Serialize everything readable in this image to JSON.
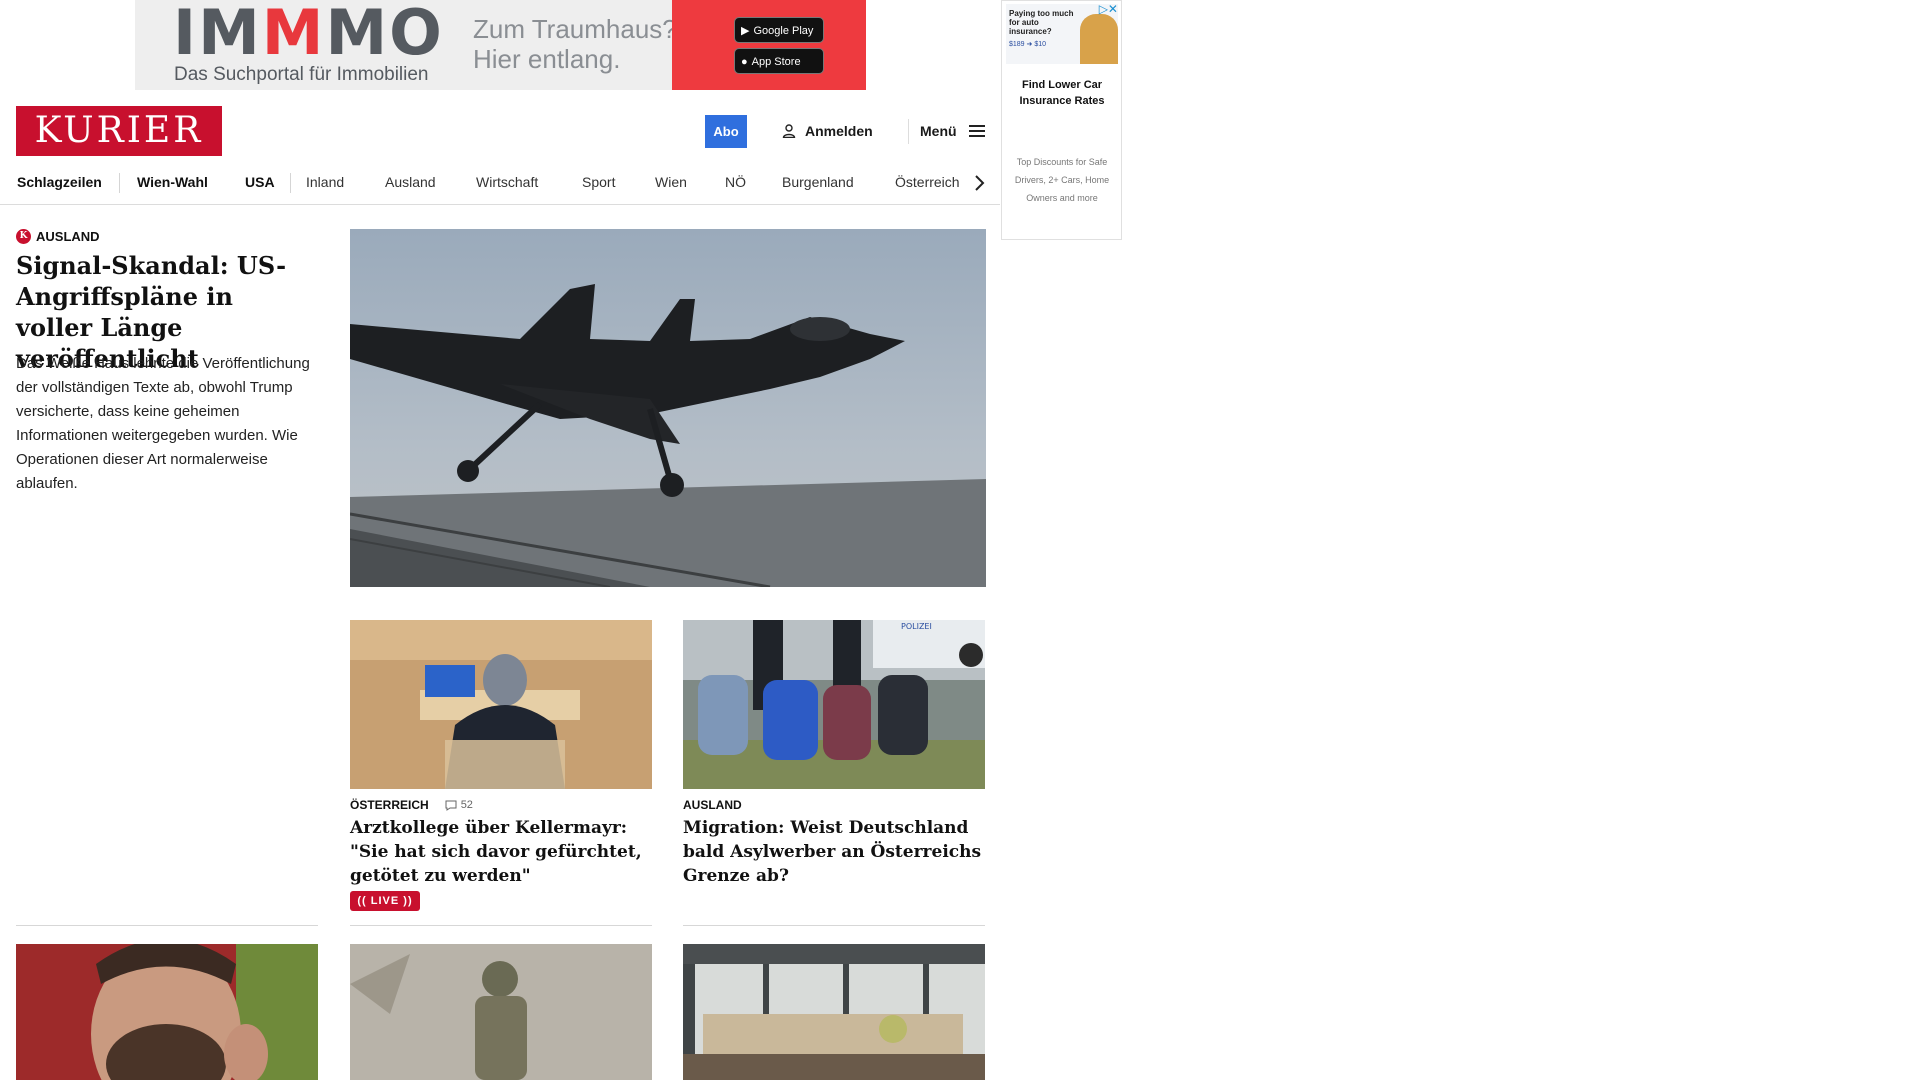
{
  "ad_banner": {
    "brand": "IMMMO",
    "tagline": "Das Suchportal für Immobilien",
    "slogan_line1": "Zum Traumhaus?",
    "slogan_line2": "Hier entlang.",
    "google_play": "Google Play",
    "app_store": "App Store",
    "colors": {
      "accent": "#ee3a3f",
      "text": "#555a60"
    }
  },
  "ad_side": {
    "thumb_text": "Paying too much for auto insurance?",
    "thumb_price": "$189 ➜ $10",
    "headline": "Find Lower Car Insurance Rates",
    "description": "Top Discounts for Safe Drivers, 2+ Cars, Home Owners and more"
  },
  "header": {
    "logo": "KURIER",
    "abo": "Abo",
    "login": "Anmelden",
    "menu": "Menü",
    "colors": {
      "brand": "#c8102e",
      "abo": "#2f6fde"
    }
  },
  "nav": {
    "items": [
      "Schlagzeilen",
      "Wien-Wahl",
      "USA",
      "Inland",
      "Ausland",
      "Wirtschaft",
      "Sport",
      "Wien",
      "NÖ",
      "Burgenland",
      "Österreich"
    ]
  },
  "lead": {
    "kicker": "AUSLAND",
    "title": "Signal-Skandal: US-Angriffspläne in voller Länge veröffentlicht",
    "text": "Das Weiße Haus lehnte die Veröffentlichung der vollständigen Texte ab, obwohl Trump versicherte, dass keine geheimen Informationen weitergegeben wurden. Wie Operationen dieser Art normalerweise ablaufen."
  },
  "teasers": [
    {
      "kicker": "ÖSTERREICH",
      "comments": "52",
      "title": "Arztkollege über Kellermayr: \"Sie hat sich davor gefürchtet, getötet zu werden\"",
      "live": "LIVE"
    },
    {
      "kicker": "AUSLAND",
      "title": "Migration: Weist Deutschland bald Asylwerber an Österreichs Grenze ab?",
      "image_text": "POLIZEI"
    }
  ]
}
